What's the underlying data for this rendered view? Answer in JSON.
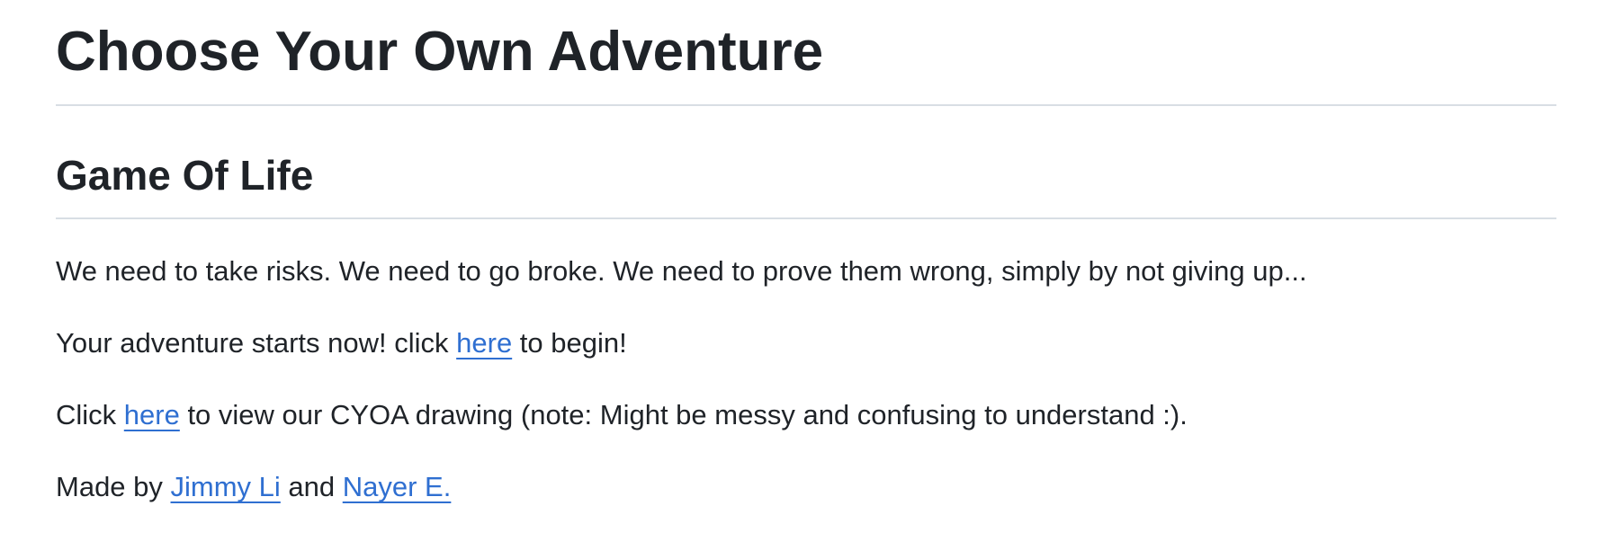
{
  "header": {
    "title": "Choose Your Own Adventure"
  },
  "section": {
    "title": "Game Of Life"
  },
  "paragraphs": {
    "intro": "We need to take risks. We need to go broke. We need to prove them wrong, simply by not giving up...",
    "start": {
      "before": "Your adventure starts now! click ",
      "link": "here",
      "after": " to begin!"
    },
    "drawing": {
      "before": "Click ",
      "link": "here",
      "after": " to view our CYOA drawing (note: Might be messy and confusing to understand :)."
    },
    "credits": {
      "before": "Made by ",
      "author1": "Jimmy Li",
      "middle": " and ",
      "author2": "Nayer E."
    }
  },
  "colors": {
    "text": "#1f2328",
    "link": "#2f6fd1",
    "rule": "#d8dee4"
  }
}
